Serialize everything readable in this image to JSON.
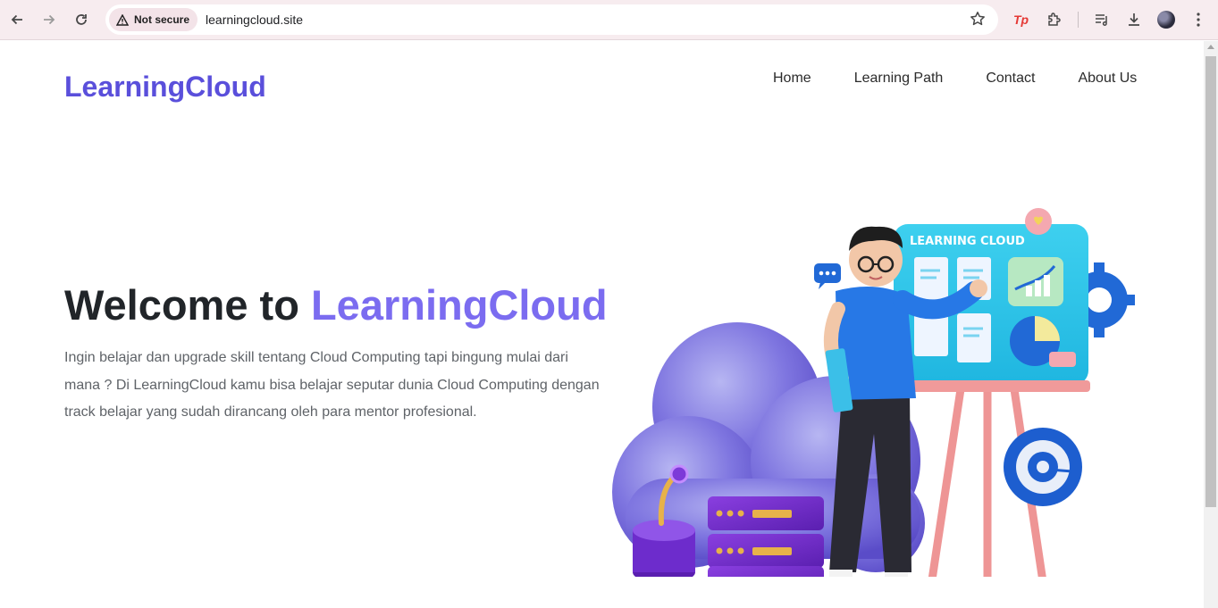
{
  "browser": {
    "security_label": "Not secure",
    "url": "learningcloud.site"
  },
  "header": {
    "brand": "LearningCloud",
    "nav": [
      {
        "label": "Home"
      },
      {
        "label": "Learning Path"
      },
      {
        "label": "Contact"
      },
      {
        "label": "About Us"
      }
    ]
  },
  "hero": {
    "title_prefix": "Welcome to ",
    "title_accent": "LearningCloud",
    "description": "Ingin belajar dan upgrade skill tentang Cloud Computing tapi bingung mulai dari mana ? Di LearningCloud kamu bisa belajar seputar dunia Cloud Computing dengan track belajar yang sudah dirancang oleh para mentor profesional.",
    "board_title": "LEARNING CLOUD"
  },
  "icons": [
    "back-icon",
    "forward-icon",
    "reload-icon",
    "warning-icon",
    "star-icon",
    "extension-tp-icon",
    "puzzle-icon",
    "reading-list-icon",
    "download-icon",
    "menu-dots-icon"
  ],
  "colors": {
    "brand": "#5a4fdb",
    "accent": "#7b6cf0",
    "heading": "#212529",
    "body_text": "#5f6368",
    "chrome_bg": "#f7ecef"
  }
}
